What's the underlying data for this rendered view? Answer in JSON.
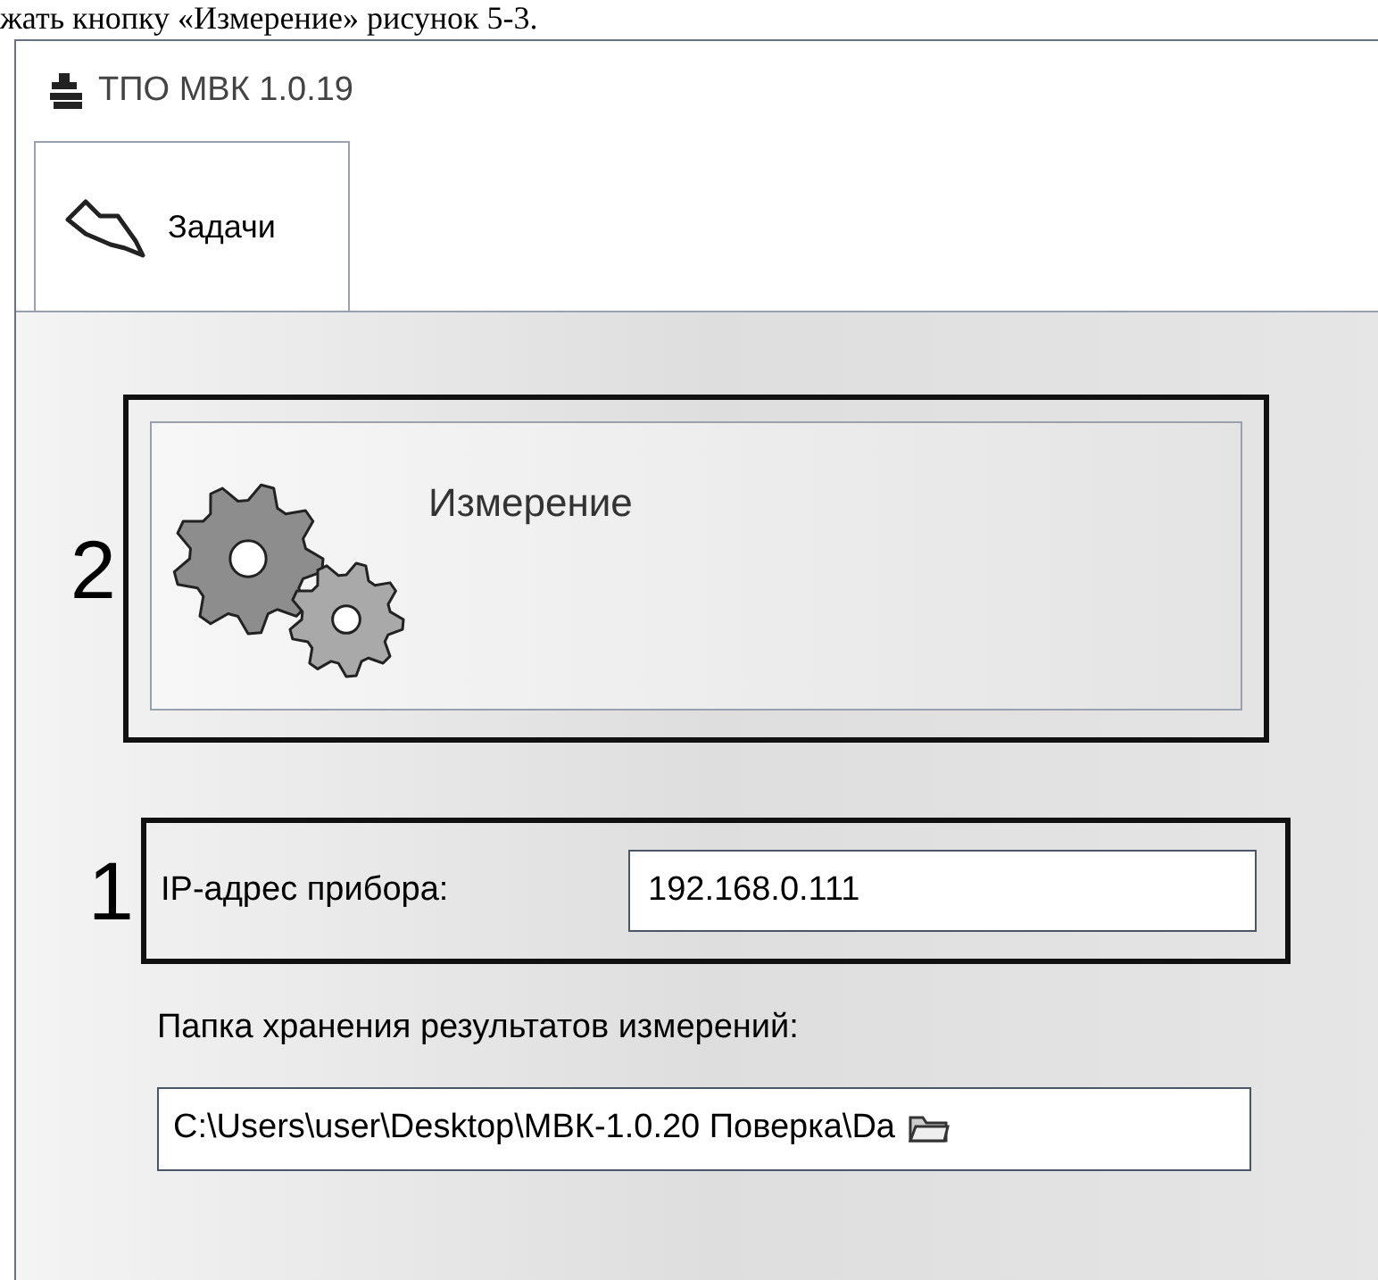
{
  "document_text": "жать кнопку «Измерение» рисунок 5-3.",
  "window": {
    "title": "ТПО МВК 1.0.19"
  },
  "tabs": [
    {
      "label": "Задачи",
      "selected": true
    }
  ],
  "callouts": [
    {
      "number": "2"
    },
    {
      "number": "1"
    }
  ],
  "task_button": {
    "label": "Измерение"
  },
  "ip_field": {
    "label": "IP-адрес прибора:",
    "value": "192.168.0.111"
  },
  "folder_field": {
    "label": "Папка хранения результатов измерений:",
    "value": "C:\\Users\\user\\Desktop\\МВК-1.0.20 Поверка\\Da"
  }
}
